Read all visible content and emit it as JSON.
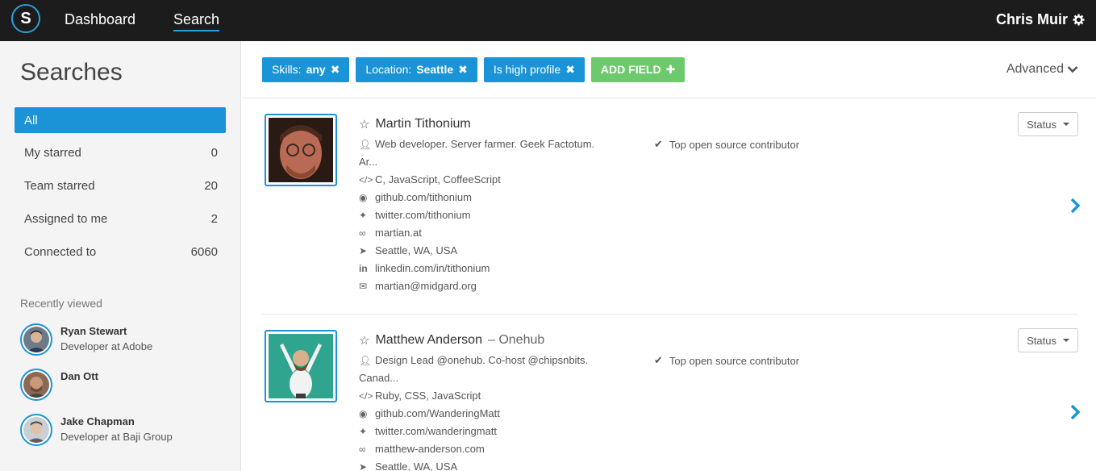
{
  "nav": {
    "logo_letter": "S",
    "links": [
      "Dashboard",
      "Search"
    ],
    "active_link": "Search",
    "user_name": "Chris Muir"
  },
  "sidebar": {
    "title": "Searches",
    "items": [
      {
        "label": "All",
        "count": ""
      },
      {
        "label": "My starred",
        "count": "0"
      },
      {
        "label": "Team starred",
        "count": "20"
      },
      {
        "label": "Assigned to me",
        "count": "2"
      },
      {
        "label": "Connected to",
        "count": "6060"
      }
    ],
    "recent_label": "Recently viewed",
    "recent": [
      {
        "name": "Ryan Stewart",
        "role": "Developer at Adobe"
      },
      {
        "name": "Dan Ott",
        "role": ""
      },
      {
        "name": "Jake Chapman",
        "role": "Developer at Baji Group"
      }
    ]
  },
  "filters": {
    "chips": [
      {
        "prefix": "Skills:",
        "value": "any"
      },
      {
        "prefix": "Location:",
        "value": "Seattle"
      },
      {
        "prefix": "Is high profile",
        "value": ""
      }
    ],
    "add_label": "ADD FIELD",
    "advanced_label": "Advanced"
  },
  "profiles": [
    {
      "name": "Martin Tithonium",
      "company": "",
      "bio": "Web developer. Server farmer. Geek Factotum.",
      "bio_cont": "Ar...",
      "skills": "C, JavaScript, CoffeeScript",
      "github": "github.com/tithonium",
      "twitter": "twitter.com/tithonium",
      "website": "martian.at",
      "location": "Seattle, WA, USA",
      "linkedin": "linkedin.com/in/tithonium",
      "email": "martian@midgard.org",
      "highlight": "Top open source contributor",
      "status_label": "Status"
    },
    {
      "name": "Matthew Anderson",
      "company": "– Onehub",
      "bio": "Design Lead @onehub. Co-host @chipsnbits.",
      "bio_cont": "Canad...",
      "skills": "Ruby, CSS, JavaScript",
      "github": "github.com/WanderingMatt",
      "twitter": "twitter.com/wanderingmatt",
      "website": "matthew-anderson.com",
      "location": "Seattle, WA, USA",
      "highlight": "Top open source contributor",
      "status_label": "Status"
    }
  ],
  "icons": {
    "accent": "#1a94d6",
    "add_green": "#6cc96c",
    "topbar": "#1c1c1c"
  }
}
